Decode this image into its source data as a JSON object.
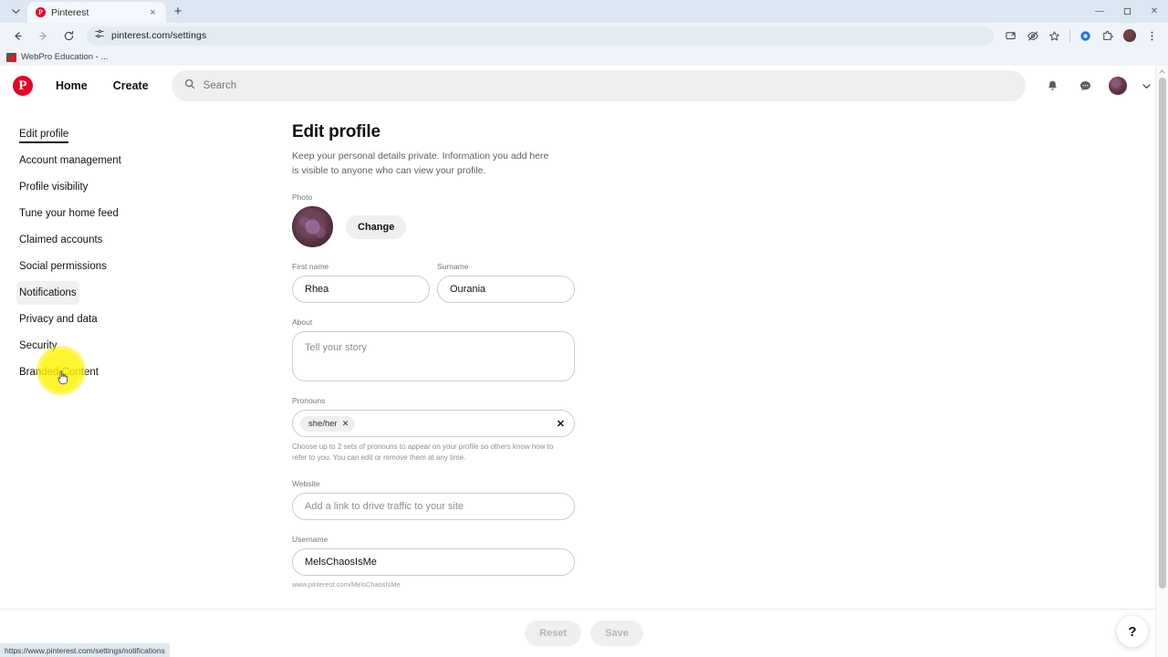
{
  "browser": {
    "tab": {
      "title": "Pinterest",
      "favicon": "pinterest-icon",
      "close": "×"
    },
    "tab_list_icon": "chevron-down-icon",
    "new_tab": "+",
    "window_controls": {
      "minimize": "—",
      "maximize": "❐",
      "close": "✕"
    },
    "nav": {
      "back": "←",
      "forward": "→",
      "reload": "⟳"
    },
    "omnibox": {
      "url": "pinterest.com/settings",
      "site_icon": "tune-icon"
    },
    "toolbar_icons": [
      "cast-icon",
      "eye-off-icon",
      "bookmark-star-icon",
      "extension-blue-icon",
      "extensions-puzzle-icon",
      "browser-profile-avatar",
      "kebab-menu-icon"
    ],
    "bookmarks": [
      {
        "label": "WebPro Education - ...",
        "favicon": "webpro-icon"
      }
    ],
    "status_url": "https://www.pinterest.com/settings/notifications"
  },
  "pinterest_header": {
    "logo": "P",
    "home_label": "Home",
    "create_label": "Create",
    "search_placeholder": "Search",
    "search_icon": "search-icon",
    "notifications_icon": "bell-icon",
    "messages_icon": "message-icon",
    "avatar": "user-avatar",
    "account_chevron": "chevron-down-icon"
  },
  "sidebar": {
    "items": [
      {
        "label": "Edit profile",
        "active": true
      },
      {
        "label": "Account management",
        "active": false
      },
      {
        "label": "Profile visibility",
        "active": false
      },
      {
        "label": "Tune your home feed",
        "active": false
      },
      {
        "label": "Claimed accounts",
        "active": false
      },
      {
        "label": "Social permissions",
        "active": false
      },
      {
        "label": "Notifications",
        "active": false,
        "hovered": true
      },
      {
        "label": "Privacy and data",
        "active": false
      },
      {
        "label": "Security",
        "active": false
      },
      {
        "label": "Branded Content",
        "active": false
      }
    ]
  },
  "main": {
    "title": "Edit profile",
    "description": "Keep your personal details private. Information you add here is visible to anyone who can view your profile.",
    "photo": {
      "label": "Photo",
      "change_button": "Change"
    },
    "first_name": {
      "label": "First name",
      "value": "Rhea"
    },
    "surname": {
      "label": "Surname",
      "value": "Ourania"
    },
    "about": {
      "label": "About",
      "placeholder": "Tell your story",
      "value": ""
    },
    "pronouns": {
      "label": "Pronouns",
      "chips": [
        {
          "text": "she/her",
          "remove": "✕"
        }
      ],
      "clear_icon": "✕",
      "helper": "Choose up to 2 sets of pronouns to appear on your profile so others know how to refer to you. You can edit or remove them at any time."
    },
    "website": {
      "label": "Website",
      "placeholder": "Add a link to drive traffic to your site",
      "value": ""
    },
    "username": {
      "label": "Username",
      "value": "MelsChaosIsMe",
      "helper": "www.pinterest.com/MelsChaosIsMe"
    }
  },
  "footer": {
    "reset_label": "Reset",
    "save_label": "Save",
    "help_label": "?"
  },
  "colors": {
    "brand_red": "#e60023",
    "highlight_yellow": "#fff300",
    "text_primary": "#111111",
    "text_muted": "#767676"
  }
}
